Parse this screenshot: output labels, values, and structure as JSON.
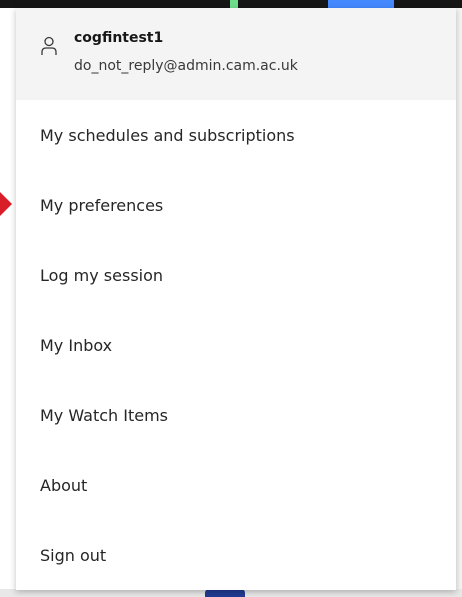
{
  "user": {
    "icon": "user-icon",
    "name": "cogfintest1",
    "email": "do_not_reply@admin.cam.ac.uk"
  },
  "menu": {
    "items": [
      {
        "label": "My schedules and subscriptions"
      },
      {
        "label": "My preferences"
      },
      {
        "label": "Log my session"
      },
      {
        "label": "My Inbox"
      },
      {
        "label": "My Watch Items"
      },
      {
        "label": "About"
      },
      {
        "label": "Sign out"
      }
    ]
  },
  "colors": {
    "header_bg": "#f4f4f4",
    "text": "#262626",
    "pointer_arrow": "#da1e28"
  }
}
